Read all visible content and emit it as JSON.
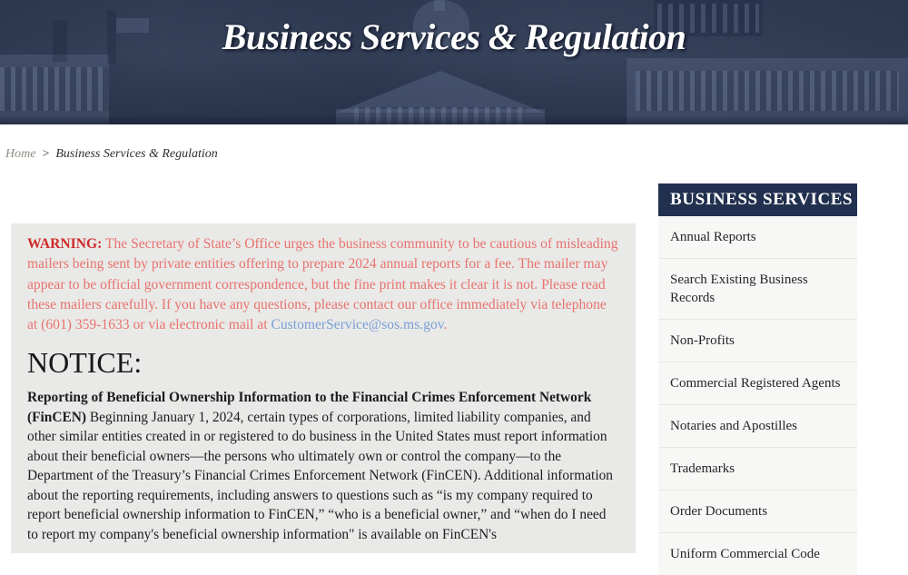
{
  "banner": {
    "title": "Business Services & Regulation",
    "background_color": "#3a465e"
  },
  "breadcrumb": {
    "home_label": "Home",
    "separator": ">",
    "current_label": "Business Services & Regulation"
  },
  "content": {
    "warning": {
      "label": "WARNING:",
      "text_before_email": " The Secretary of State’s Office urges the business community to be cautious of misleading mailers being sent by private entities offering to prepare 2024 annual reports for a fee. The mailer may appear to be official government correspondence, but the fine print makes it clear it is not. Please read these mailers carefully. If you have any questions, please contact our office immediately via telephone at (601) 359-1633 or via electronic mail at ",
      "phone": "(601) 359-1633",
      "email": "CustomerService@sos.ms.gov",
      "text_after_email": ".",
      "label_color": "#cf2a28",
      "body_color": "#e8736e",
      "link_color": "#7b9fd6"
    },
    "notice_heading": "NOTICE:",
    "notice_lead": "Reporting of Beneficial Ownership Information to the Financial Crimes Enforcement Network (FinCEN)",
    "notice_body": " Beginning January 1, 2024, certain types of corporations, limited liability companies, and other similar entities created in or registered to do business in the United States must report information about their beneficial owners—the persons who ultimately own or control the company—to the Department of the Treasury’s Financial Crimes Enforcement Network (FinCEN). Additional information about the reporting requirements, including answers to questions such as “is my company required to report beneficial ownership information to FinCEN,” “who is a beneficial owner,” and “when do I need to report my company's beneficial ownership information\" is available on FinCEN's"
  },
  "sidebar": {
    "header": "BUSINESS SERVICES",
    "header_color": "#22304f",
    "items": [
      {
        "label": "Annual Reports"
      },
      {
        "label": "Search Existing Business Records"
      },
      {
        "label": "Non-Profits"
      },
      {
        "label": "Commercial Registered Agents"
      },
      {
        "label": "Notaries and Apostilles"
      },
      {
        "label": "Trademarks"
      },
      {
        "label": "Order Documents"
      },
      {
        "label": "Uniform Commercial Code"
      }
    ]
  }
}
